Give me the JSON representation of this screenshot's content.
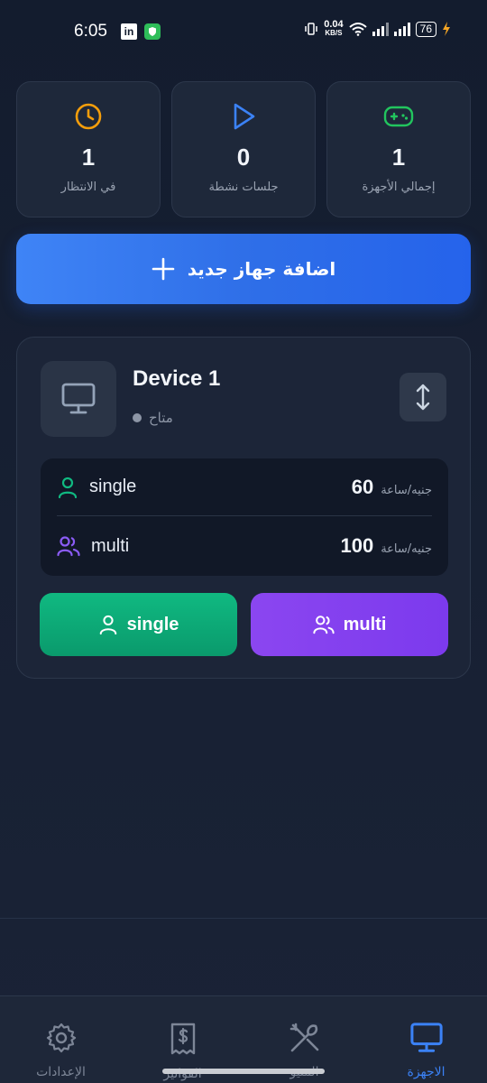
{
  "status_bar": {
    "time": "6:05",
    "linkedin_label": "in",
    "net_speed": "0.04",
    "net_unit": "KB/S",
    "battery": "76"
  },
  "stats": [
    {
      "value": "1",
      "label": "إجمالي الأجهزة",
      "icon": "gamepad-icon",
      "color": "#22c55e"
    },
    {
      "value": "0",
      "label": "جلسات نشطة",
      "icon": "play-icon",
      "color": "#3b82f6"
    },
    {
      "value": "1",
      "label": "في الانتظار",
      "icon": "clock-icon",
      "color": "#f59e0b"
    }
  ],
  "add_device": {
    "label": "اضافة جهاز جديد",
    "icon": "plus-icon"
  },
  "device": {
    "name": "Device 1",
    "status": "متاح",
    "rates": [
      {
        "name": "single",
        "price": "60",
        "unit": "جنيه/ساعة",
        "icon": "user-icon",
        "color": "#10b981"
      },
      {
        "name": "multi",
        "price": "100",
        "unit": "جنيه/ساعة",
        "icon": "users-icon",
        "color": "#8b5cf6"
      }
    ],
    "actions": {
      "single_label": "single",
      "multi_label": "multi"
    }
  },
  "nav": {
    "items": [
      {
        "label": "الاجهزة",
        "icon": "monitor-icon",
        "active": true
      },
      {
        "label": "المنيو",
        "icon": "utensils-icon",
        "active": false
      },
      {
        "label": "الفواتير",
        "icon": "receipt-icon",
        "active": false
      },
      {
        "label": "الإعدادات",
        "icon": "gear-icon",
        "active": false
      }
    ]
  },
  "colors": {
    "background": "#172033",
    "card": "#1e283a",
    "primary": "#3b82f6",
    "success": "#10b981",
    "purple": "#8b5cf6",
    "warning": "#f59e0b"
  }
}
